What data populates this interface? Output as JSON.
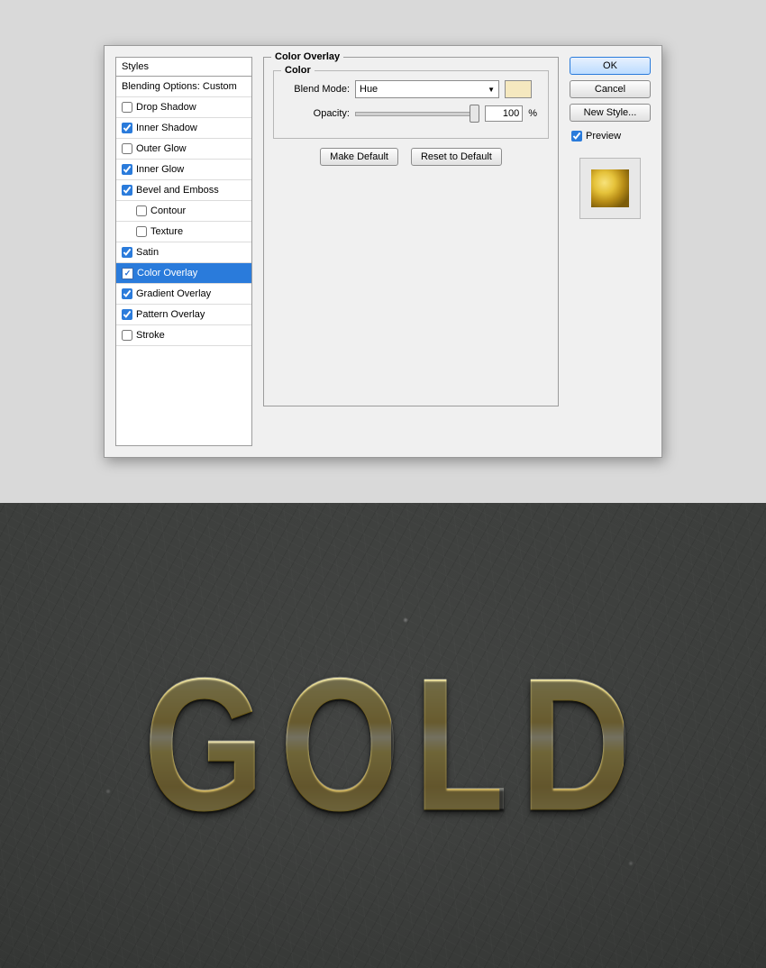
{
  "dialog": {
    "styles_header": "Styles",
    "blending_options": "Blending Options: Custom",
    "styles": [
      {
        "id": "drop-shadow",
        "label": "Drop Shadow",
        "checked": false,
        "level": 1
      },
      {
        "id": "inner-shadow",
        "label": "Inner Shadow",
        "checked": true,
        "level": 1
      },
      {
        "id": "outer-glow",
        "label": "Outer Glow",
        "checked": false,
        "level": 1
      },
      {
        "id": "inner-glow",
        "label": "Inner Glow",
        "checked": true,
        "level": 1
      },
      {
        "id": "bevel-emboss",
        "label": "Bevel and Emboss",
        "checked": true,
        "level": 1
      },
      {
        "id": "contour",
        "label": "Contour",
        "checked": false,
        "level": 2
      },
      {
        "id": "texture",
        "label": "Texture",
        "checked": false,
        "level": 2
      },
      {
        "id": "satin",
        "label": "Satin",
        "checked": true,
        "level": 1
      },
      {
        "id": "color-overlay",
        "label": "Color Overlay",
        "checked": true,
        "level": 1,
        "selected": true
      },
      {
        "id": "gradient-overlay",
        "label": "Gradient Overlay",
        "checked": true,
        "level": 1
      },
      {
        "id": "pattern-overlay",
        "label": "Pattern Overlay",
        "checked": true,
        "level": 1
      },
      {
        "id": "stroke",
        "label": "Stroke",
        "checked": false,
        "level": 1
      }
    ],
    "panel": {
      "title": "Color Overlay",
      "inner_title": "Color",
      "blend_mode_label": "Blend Mode:",
      "blend_mode_value": "Hue",
      "opacity_label": "Opacity:",
      "opacity_value": "100",
      "opacity_unit": "%",
      "swatch_hex": "#f5e8bf",
      "make_default": "Make Default",
      "reset_default": "Reset to Default"
    },
    "buttons": {
      "ok": "OK",
      "cancel": "Cancel",
      "new_style": "New Style...",
      "preview": "Preview",
      "preview_checked": true
    }
  },
  "artwork": {
    "text": "GOLD"
  }
}
